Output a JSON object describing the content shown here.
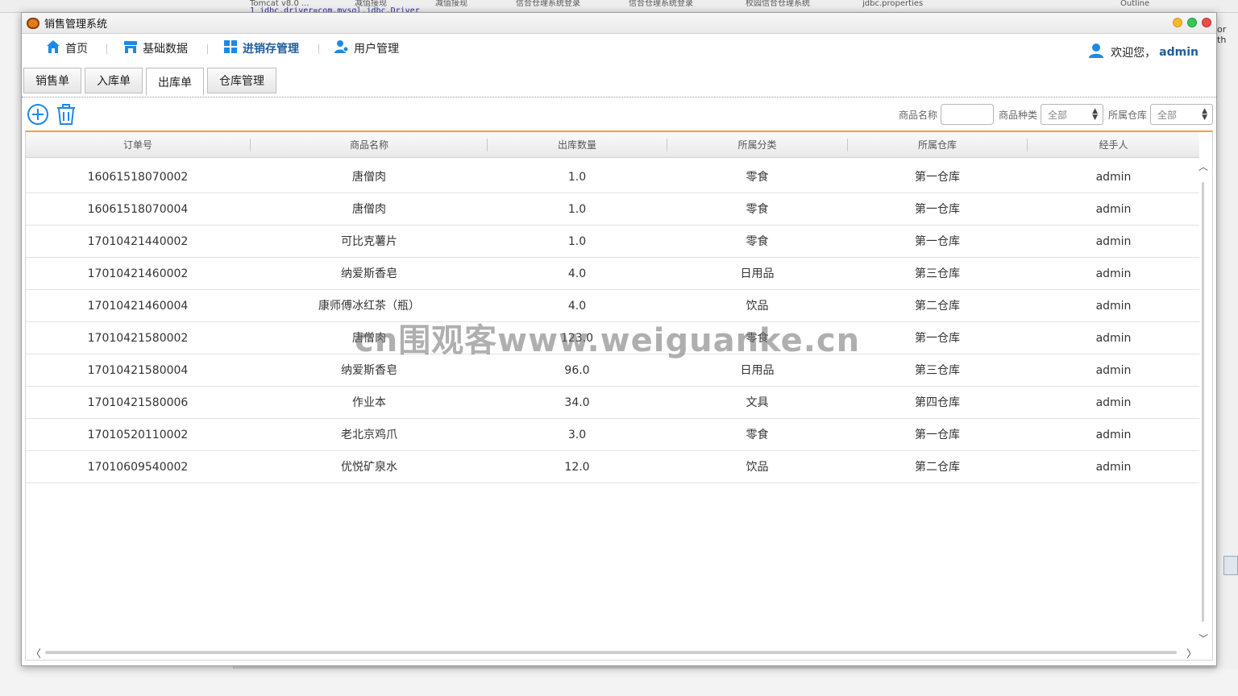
{
  "background": {
    "tabs": [
      "Tomcat v8.0 ...",
      "减值接现",
      "减值接现",
      "信合仓理系统登录",
      "信合仓理系统登录",
      "校园信合仓理系统",
      "jdbc.properties",
      "Outline"
    ],
    "code_line": "1 jdbc.driver=com.mysql.jdbc.Driver",
    "right_text": "or th"
  },
  "window": {
    "title": "销售管理系统"
  },
  "menu": {
    "items": [
      {
        "label": "首页",
        "icon": "home-icon"
      },
      {
        "label": "基础数据",
        "icon": "store-icon"
      },
      {
        "label": "进销存管理",
        "icon": "grid-icon"
      },
      {
        "label": "用户管理",
        "icon": "users-icon"
      }
    ],
    "welcome_prefix": "欢迎您，",
    "welcome_user": "admin"
  },
  "subtabs": [
    "销售单",
    "入库单",
    "出库单",
    "仓库管理"
  ],
  "active_subtab": "出库单",
  "toolbar": {
    "add_icon": "plus-circle-icon",
    "delete_icon": "trash-icon"
  },
  "filters": {
    "product_name_label": "商品名称",
    "product_name_value": "",
    "category_label": "商品种类",
    "category_value": "全部",
    "warehouse_label": "所属仓库",
    "warehouse_value": "全部"
  },
  "table": {
    "columns": [
      "订单号",
      "商品名称",
      "出库数量",
      "所属分类",
      "所属仓库",
      "经手人"
    ],
    "rows": [
      [
        "16061518070002",
        "唐僧肉",
        "1.0",
        "零食",
        "第一仓库",
        "admin"
      ],
      [
        "16061518070004",
        "唐僧肉",
        "1.0",
        "零食",
        "第一仓库",
        "admin"
      ],
      [
        "17010421440002",
        "可比克薯片",
        "1.0",
        "零食",
        "第一仓库",
        "admin"
      ],
      [
        "17010421460002",
        "纳爱斯香皂",
        "4.0",
        "日用品",
        "第三仓库",
        "admin"
      ],
      [
        "17010421460004",
        "康师傅冰红茶（瓶）",
        "4.0",
        "饮品",
        "第二仓库",
        "admin"
      ],
      [
        "17010421580002",
        "唐僧肉",
        "123.0",
        "零食",
        "第一仓库",
        "admin"
      ],
      [
        "17010421580004",
        "纳爱斯香皂",
        "96.0",
        "日用品",
        "第三仓库",
        "admin"
      ],
      [
        "17010421580006",
        "作业本",
        "34.0",
        "文具",
        "第四仓库",
        "admin"
      ],
      [
        "17010520110002",
        "老北京鸡爪",
        "3.0",
        "零食",
        "第一仓库",
        "admin"
      ],
      [
        "17010609540002",
        "优悦矿泉水",
        "12.0",
        "饮品",
        "第二仓库",
        "admin"
      ]
    ]
  },
  "watermark": "cn围观客www.weiguanke.cn",
  "colors": {
    "accent": "#1f5e9c",
    "icon_blue": "#1e88e5",
    "header_border": "#f0a040"
  }
}
